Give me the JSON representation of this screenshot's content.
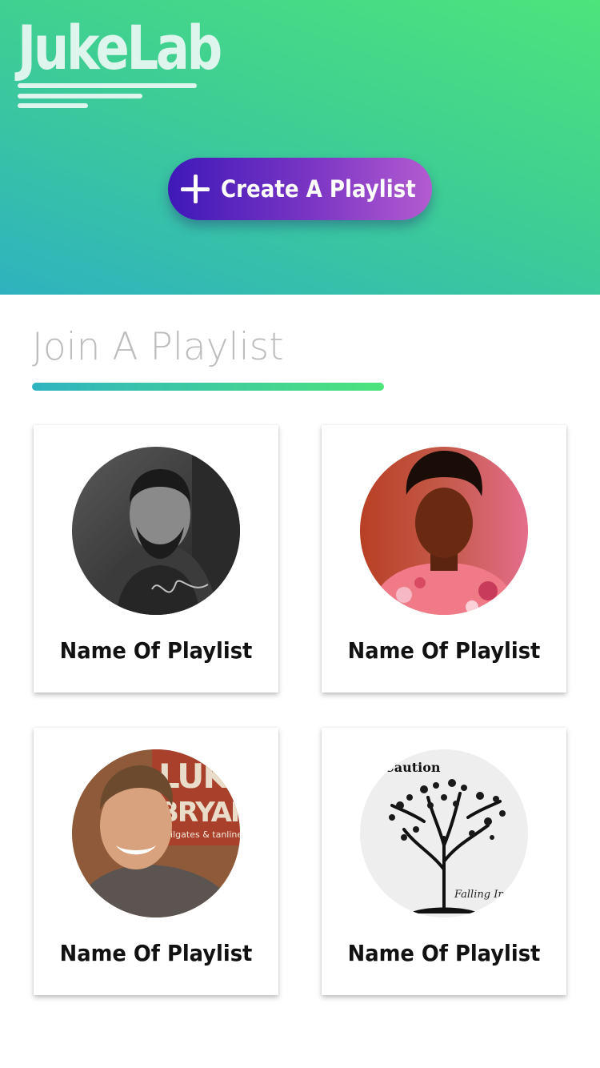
{
  "header": {
    "logo_text": "JukeLab",
    "create_button_label": "Create A Playlist",
    "create_button_icon": "plus-icon"
  },
  "join_section": {
    "title": "Join A Playlist"
  },
  "playlists": [
    {
      "name": "Name Of Playlist",
      "cover": "drake-album-cover",
      "cover_text": ""
    },
    {
      "name": "Name Of Playlist",
      "cover": "childish-gambino-album-cover",
      "cover_text": ""
    },
    {
      "name": "Name Of Playlist",
      "cover": "luke-bryan-album-cover",
      "cover_text": "LUKE BRYAN tailgates & tanlines"
    },
    {
      "name": "Name Of Playlist",
      "cover": "tree-illustration-album-cover",
      "cover_text": "Caution  Falling Into P"
    }
  ],
  "colors": {
    "hero_gradient_start": "#4de47c",
    "hero_gradient_end": "#2fb2bf",
    "button_gradient_start": "#3e18b8",
    "button_gradient_end": "#b35bd0",
    "logo": "#ddf5ec",
    "section_title": "#bdbdbd"
  }
}
